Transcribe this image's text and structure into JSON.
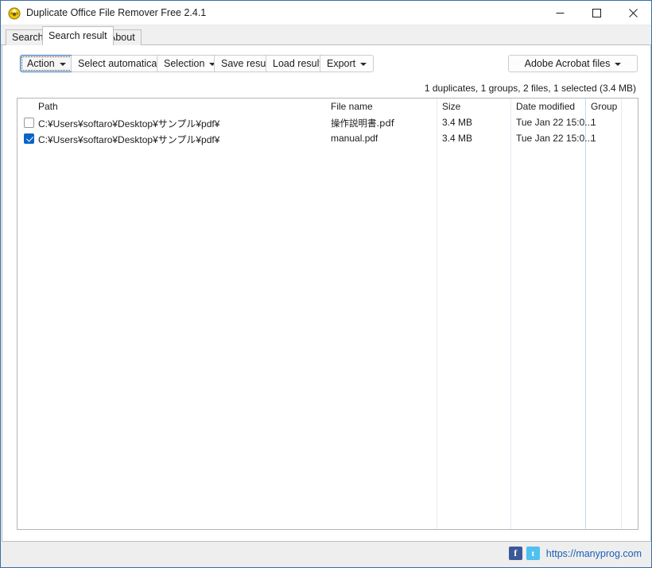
{
  "window": {
    "title": "Duplicate Office File Remover Free 2.4.1",
    "icon": "app-shield-icon",
    "controls": {
      "minimize": "─",
      "maximize": "☐",
      "close": "✕"
    }
  },
  "tabs": [
    {
      "label": "Search",
      "selected": false
    },
    {
      "label": "Search result",
      "selected": true
    },
    {
      "label": "About",
      "selected": false
    }
  ],
  "toolbar": {
    "action_label": "Action",
    "select_automatically_label": "Select automatically",
    "selection_label": "Selection",
    "save_result_label": "Save result",
    "load_result_label": "Load result",
    "export_label": "Export",
    "file_type_label": "Adobe Acrobat files"
  },
  "summary": "1 duplicates, 1 groups, 2 files, 1 selected (3.4 MB)",
  "list": {
    "columns": [
      "Path",
      "File name",
      "Size",
      "Date modified",
      "Group"
    ],
    "rows": [
      {
        "checked": false,
        "path": "C:¥Users¥softaro¥Desktop¥サンプル¥pdf¥",
        "file_name": "操作説明書.pdf",
        "size": "3.4 MB",
        "date_modified": "Tue Jan 22 15:0...",
        "group": "1"
      },
      {
        "checked": true,
        "path": "C:¥Users¥softaro¥Desktop¥サンプル¥pdf¥",
        "file_name": "manual.pdf",
        "size": "3.4 MB",
        "date_modified": "Tue Jan 22 15:0...",
        "group": "1"
      }
    ]
  },
  "statusbar": {
    "facebook_icon": "facebook-icon",
    "facebook_glyph": "f",
    "twitter_icon": "twitter-icon",
    "twitter_glyph": "t",
    "site_url": "https://manyprog.com"
  },
  "colors": {
    "window_border": "#3a6ea5",
    "accent_checkbox": "#0b63c5",
    "link": "#1a5fb4",
    "facebook": "#3b5998",
    "twitter": "#4fc0f0"
  }
}
